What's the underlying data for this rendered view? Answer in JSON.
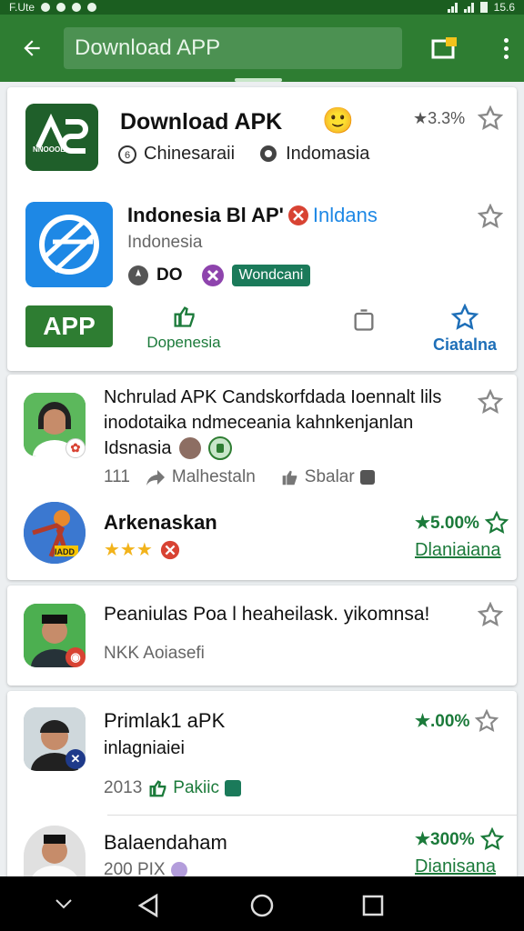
{
  "status_bar": {
    "left_text": "F.Ute",
    "time": "15.6"
  },
  "app_bar": {
    "search_text": "Download APP"
  },
  "featured": {
    "title": "Download APK",
    "emoji": "🙂",
    "rating": "★3.3%",
    "tag1": "Chinesaraii",
    "tag2": "Indomasia",
    "app_logo_text": "NNOOOE",
    "app2_title": "Indonesia Bl AP' ",
    "app2_publisher": "Inldans",
    "app2_subtitle": "Indonesia",
    "app2_chip1": "DO",
    "app2_chip2": "Wondcani",
    "primary_button": "APP",
    "action1": "Dopenesia",
    "action2": "Ciatalna"
  },
  "list": [
    {
      "title_line1": "Nchrulad APK Candskorfdada Ioennalt lils",
      "title_line2": "inodotaika ndmeceania kahnkenjanlan",
      "title_line3": "Idsnasia",
      "count": "111",
      "share": "Malhestaln",
      "like": "Sbalar"
    },
    {
      "title": "Arkenaskan",
      "stars": "★★★",
      "rating": "★5.00%",
      "link": "Dlaniaiana",
      "icon_text": "IADD"
    },
    {
      "title": "Peaniulas Poa l heaheilask. yikomnsa!",
      "subtitle": "NKK Aoiasefi"
    },
    {
      "title": "Primlak1 aPK",
      "subtitle": "inlagniaiei",
      "meta": "2013",
      "tag": "Pakiic",
      "rating": "★.00%"
    },
    {
      "title": "Balaendaham",
      "meta": "200 PIX",
      "rating": "★300%",
      "link": "Dianisana"
    }
  ],
  "colors": {
    "primary": "#2e7d32",
    "dark": "#1b5e20",
    "accent": "#1b7a3a",
    "star": "#f2b31b"
  }
}
